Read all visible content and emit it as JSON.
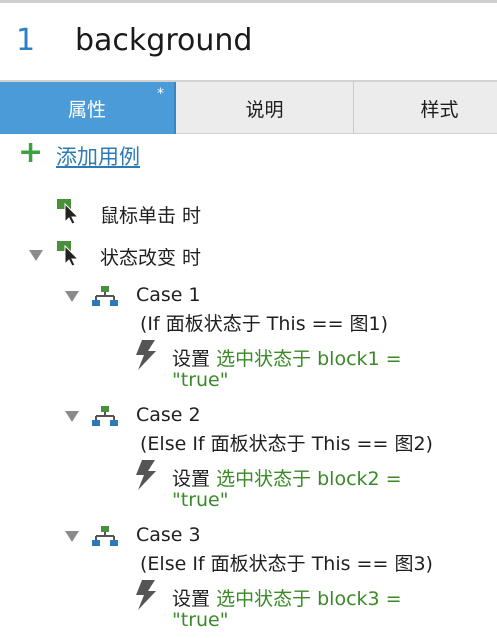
{
  "header": {
    "number": "1",
    "title": "background"
  },
  "tabs": [
    {
      "label": "属性",
      "modified_marker": "*",
      "active": true
    },
    {
      "label": "说明",
      "active": false
    },
    {
      "label": "样式",
      "active": false
    }
  ],
  "add_case": {
    "label": "添加用例"
  },
  "events": [
    {
      "label": "鼠标单击 时"
    },
    {
      "label": "状态改变 时"
    }
  ],
  "cases": [
    {
      "name": "Case 1",
      "condition": "(If 面板状态于 This == 图1)",
      "action_verb": "设置",
      "action_target_1": "选中状态于 block1 =",
      "action_target_2": "\"true\""
    },
    {
      "name": "Case 2",
      "condition": "(Else If 面板状态于 This == 图2)",
      "action_verb": "设置",
      "action_target_1": "选中状态于 block2 =",
      "action_target_2": "\"true\""
    },
    {
      "name": "Case 3",
      "condition": "(Else If 面板状态于 This == 图3)",
      "action_verb": "设置",
      "action_target_1": "选中状态于 block3 =",
      "action_target_2": "\"true\""
    }
  ],
  "colors": {
    "accent": "#4a9bd8",
    "number": "#2b7fc6",
    "plus": "#3fa03f",
    "link": "#2d7bb6",
    "action": "#3a8a27",
    "event_icon": "#4a8f3a"
  },
  "icons": {
    "add": "plus-icon",
    "event": "cursor-event-icon",
    "case": "case-hierarchy-icon",
    "action": "lightning-icon",
    "expand": "triangle-down-icon"
  }
}
